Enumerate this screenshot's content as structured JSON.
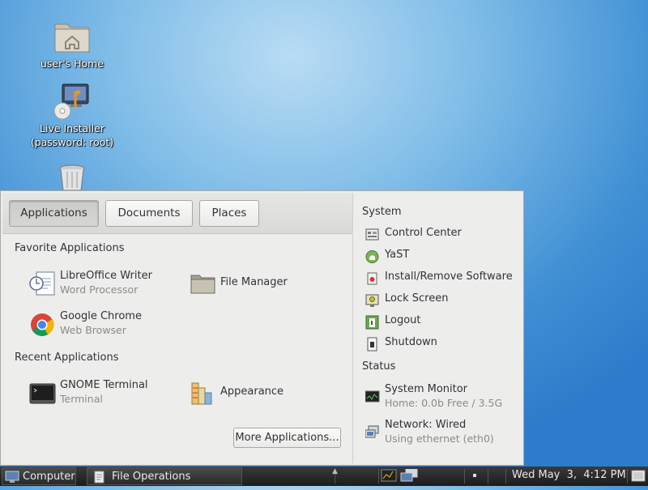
{
  "desktop": {
    "icons": [
      {
        "label": "user's Home",
        "icon": "home-folder-icon"
      },
      {
        "label": "Live Installer\n(password: root)",
        "line1": "Live Installer",
        "line2": "(password: root)",
        "icon": "installer-icon"
      },
      {
        "label": "",
        "icon": "trash-icon"
      }
    ]
  },
  "menu": {
    "tabs": [
      {
        "label": "Applications",
        "active": true
      },
      {
        "label": "Documents",
        "active": false
      },
      {
        "label": "Places",
        "active": false
      }
    ],
    "favorites_header": "Favorite Applications",
    "favorites": [
      {
        "name": "LibreOffice Writer",
        "desc": "Word Processor",
        "icon": "libreoffice-writer-icon"
      },
      {
        "name": "File Manager",
        "desc": "",
        "icon": "file-manager-icon"
      },
      {
        "name": "Google Chrome",
        "desc": "Web Browser",
        "icon": "chrome-icon"
      }
    ],
    "recent_header": "Recent Applications",
    "recent": [
      {
        "name": "GNOME Terminal",
        "desc": "Terminal",
        "icon": "terminal-icon"
      },
      {
        "name": "Appearance",
        "desc": "",
        "icon": "appearance-icon"
      }
    ],
    "more_button": "More Applications...",
    "system_header": "System",
    "system_items": [
      {
        "label": "Control Center",
        "icon": "control-center-icon"
      },
      {
        "label": "YaST",
        "icon": "yast-icon"
      },
      {
        "label": "Install/Remove Software",
        "icon": "software-icon"
      },
      {
        "label": "Lock Screen",
        "icon": "lock-screen-icon"
      },
      {
        "label": "Logout",
        "icon": "logout-icon"
      },
      {
        "label": "Shutdown",
        "icon": "shutdown-icon"
      }
    ],
    "status_header": "Status",
    "status_items": [
      {
        "label": "System Monitor",
        "sub": "Home: 0.0b Free / 3.5G",
        "icon": "system-monitor-icon"
      },
      {
        "label": "Network: Wired",
        "sub": "Using ethernet (eth0)",
        "icon": "network-icon"
      }
    ]
  },
  "taskbar": {
    "computer_label": "Computer",
    "window_label": "File Operations",
    "clock": "Wed May  3,  4:12 PM"
  }
}
